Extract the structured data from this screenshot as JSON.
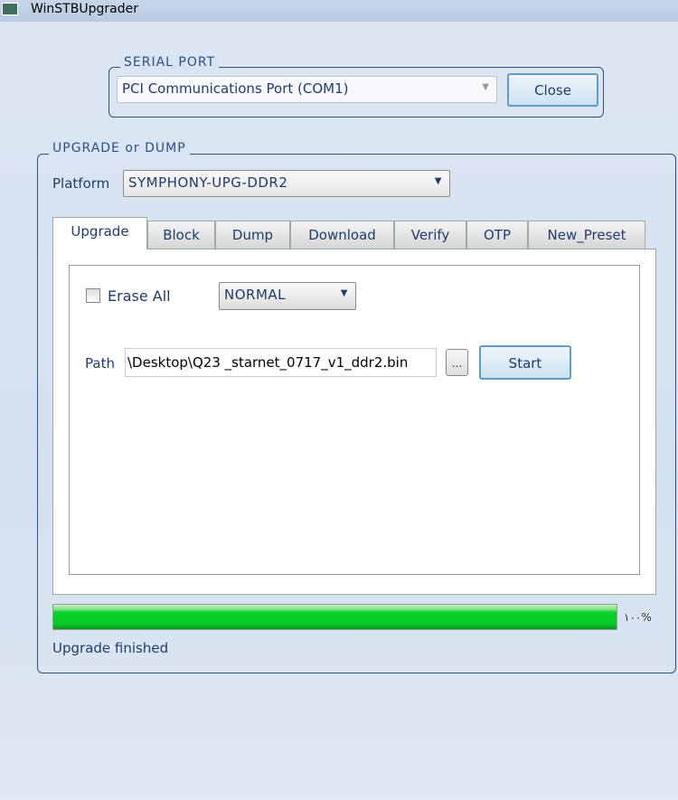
{
  "window": {
    "title": "WinSTBUpgrader"
  },
  "serial": {
    "legend": "SERIAL PORT",
    "port": "PCI Communications Port (COM1)",
    "close_label": "Close"
  },
  "upgrade_group": {
    "legend": "UPGRADE or DUMP",
    "platform_label": "Platform",
    "platform_value": "SYMPHONY-UPG-DDR2"
  },
  "tabs": [
    {
      "label": "Upgrade",
      "active": true
    },
    {
      "label": "Block"
    },
    {
      "label": "Dump"
    },
    {
      "label": "Download"
    },
    {
      "label": "Verify"
    },
    {
      "label": "OTP"
    },
    {
      "label": "New_Preset"
    }
  ],
  "upgrade_tab": {
    "erase_all_label": "Erase All",
    "erase_all_checked": false,
    "mode_value": "NORMAL",
    "path_label": "Path",
    "path_value": "\\Desktop\\Q23 _starnet_0717_v1_ddr2.bin",
    "browse_label": "...",
    "start_label": "Start"
  },
  "progress": {
    "percent": 100,
    "percent_text": "۱۰۰%",
    "color": "#08d22a"
  },
  "status": "Upgrade finished"
}
